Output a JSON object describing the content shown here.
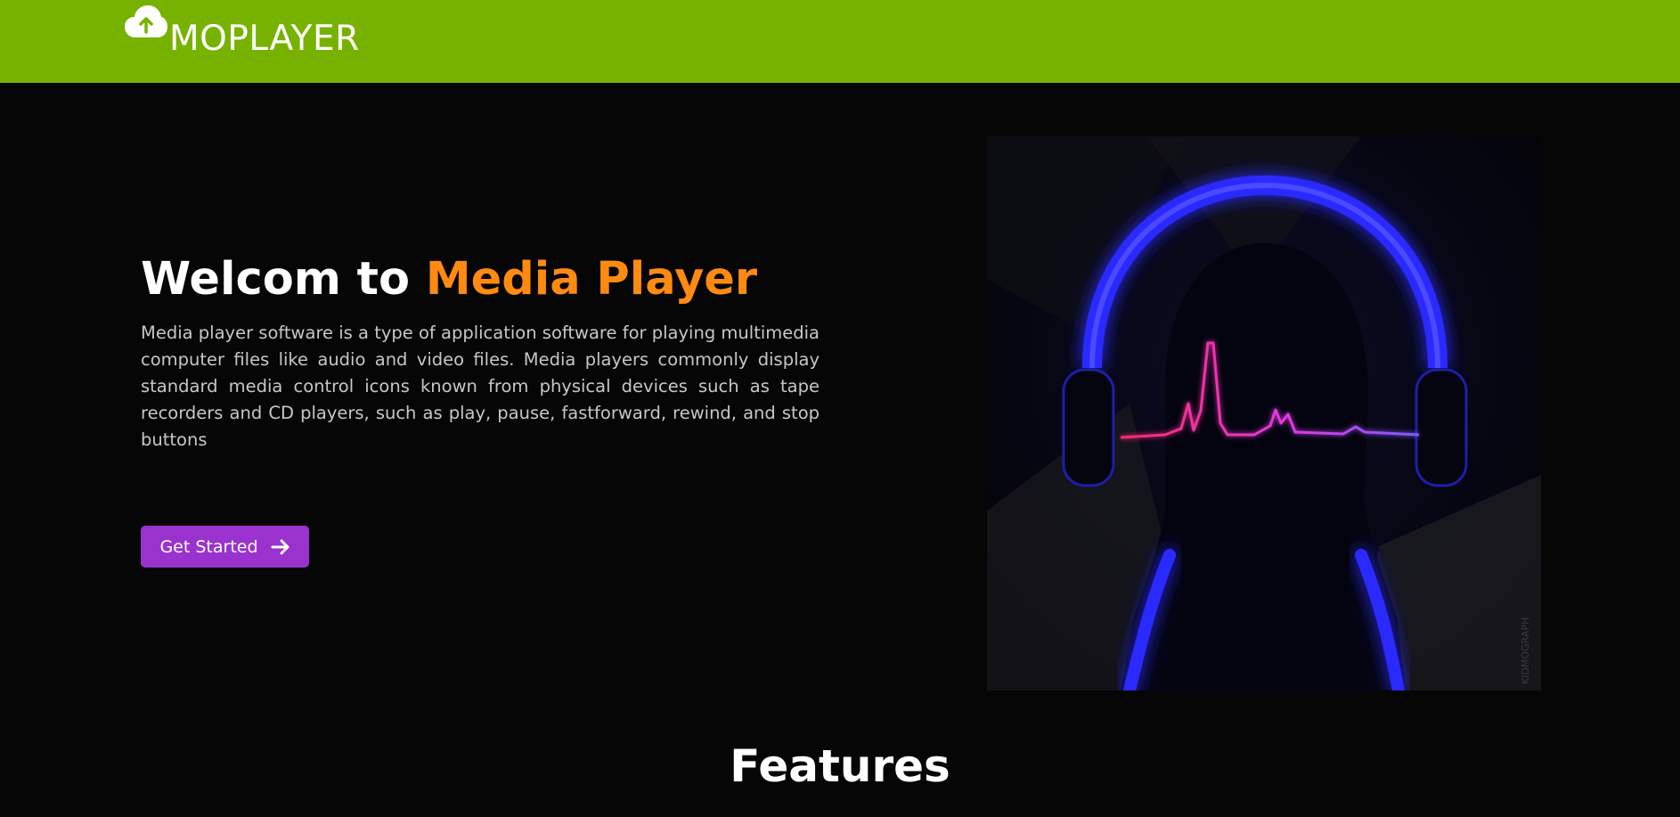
{
  "navbar": {
    "brand": "MOPLAYER",
    "logo_icon": "cloud-upload-icon",
    "bg_color": "#78b200"
  },
  "hero": {
    "title_prefix": "Welcom to ",
    "title_accent": "Media Player",
    "accent_color": "#ff8a12",
    "description": "Media player software is a type of application software for playing multimedia computer files like audio and video files. Media players commonly display standard media control icons known from physical devices such as tape recorders and CD players, such as play, pause, fastforward, rewind, and stop buttons",
    "cta_label": "Get Started",
    "cta_icon": "arrow-right-icon",
    "cta_color": "#9a32cd",
    "image_watermark": "KIDMOGRAPH"
  },
  "features": {
    "heading": "Features"
  }
}
